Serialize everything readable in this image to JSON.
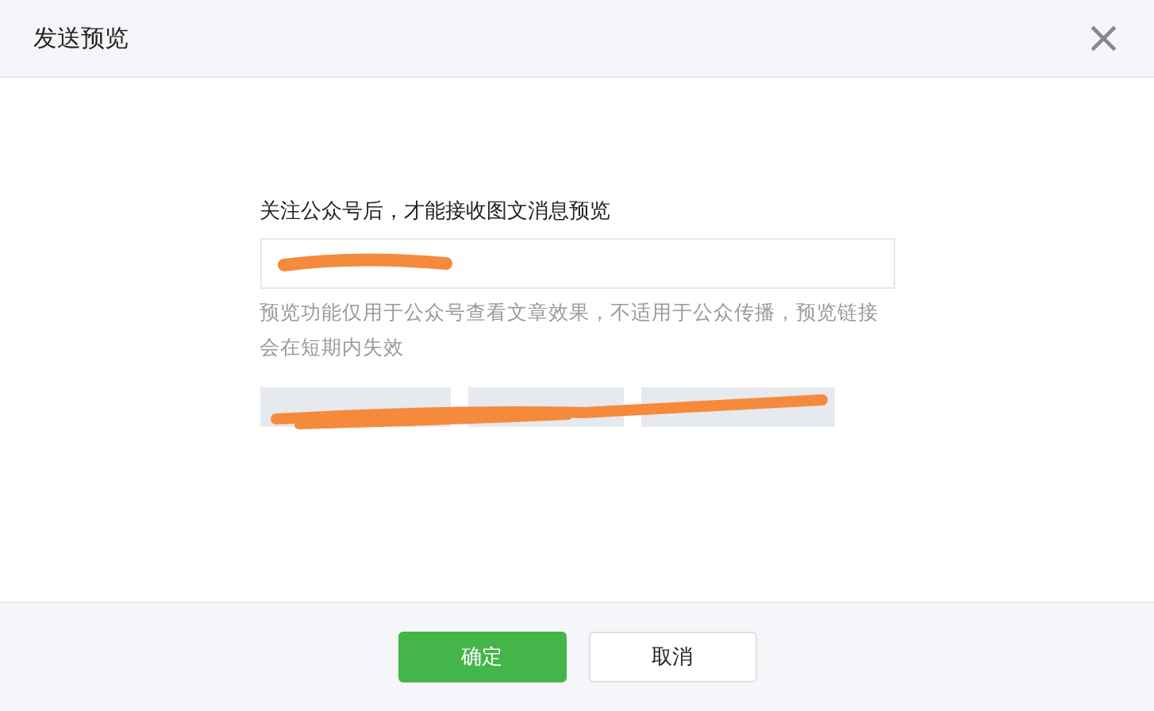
{
  "dialog": {
    "title": "发送预览",
    "close": "×"
  },
  "form": {
    "label": "关注公众号后，才能接收图文消息预览",
    "hint": "预览功能仅用于公众号查看文章效果，不适用于公众传播，预览链接会在短期内失效"
  },
  "buttons": [
    {
      "kind": "primary",
      "label": "确定"
    },
    {
      "kind": "default",
      "label": "取消"
    }
  ]
}
